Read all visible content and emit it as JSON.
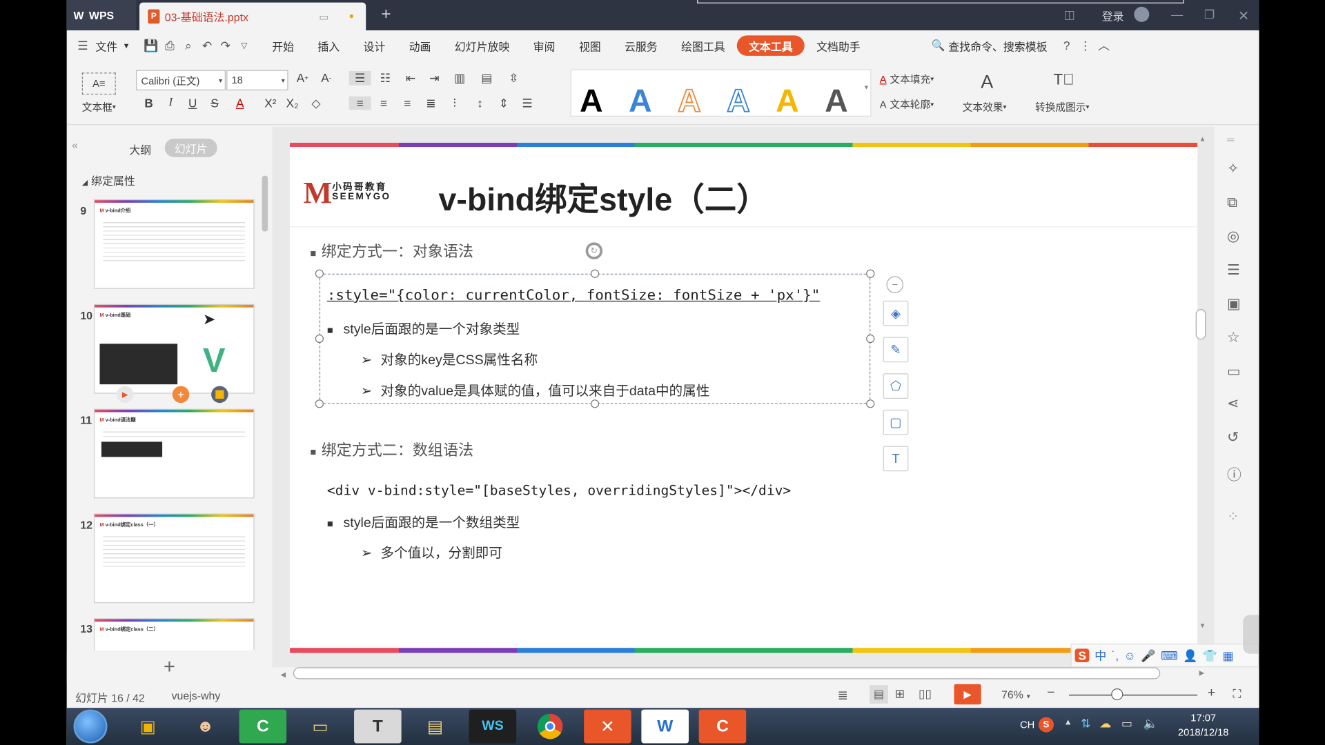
{
  "titlebar": {
    "app_name": "WPS",
    "doc_tab": "03-基础语法.pptx",
    "login_label": "登录"
  },
  "menubar": {
    "file_label": "文件",
    "items": [
      "开始",
      "插入",
      "设计",
      "动画",
      "幻灯片放映",
      "审阅",
      "视图",
      "云服务",
      "绘图工具",
      "文本工具",
      "文档助手"
    ],
    "active_item": "文本工具",
    "search_label": "查找命令、搜索模板"
  },
  "ribbon": {
    "textbox_label": "文本框",
    "font_name": "Calibri (正文)",
    "font_size": "18",
    "text_fill": "文本填充",
    "text_outline": "文本轮廓",
    "text_effect": "文本效果",
    "convert_label": "转换成图示",
    "style_A": "A"
  },
  "leftpanel": {
    "tab_outline": "大纲",
    "tab_slides": "幻灯片",
    "section_label": "绑定属性",
    "slides": [
      {
        "num": "9",
        "title": "v-bind介绍"
      },
      {
        "num": "10",
        "title": "v-bind基础"
      },
      {
        "num": "11",
        "title": "v-bind语法糖"
      },
      {
        "num": "12",
        "title": "v-bind绑定class（一）"
      },
      {
        "num": "13",
        "title": "v-bind绑定class（二）"
      }
    ]
  },
  "slide": {
    "logo_cn": "小码哥教育",
    "logo_en": "SEEMYGO",
    "title": "v-bind绑定style（二）",
    "section1": "绑定方式一：对象语法",
    "code1": ":style=\"{color: currentColor, fontSize: fontSize + 'px'}\"",
    "bullet1": "style后面跟的是一个对象类型",
    "sub1": "对象的key是CSS属性名称",
    "sub2": "对象的value是具体赋的值，值可以来自于data中的属性",
    "section2": "绑定方式二：数组语法",
    "code2": "<div v-bind:style=\"[baseStyles, overridingStyles]\"></div>",
    "bullet2": "style后面跟的是一个数组类型",
    "sub3": "多个值以，分割即可"
  },
  "statusbar": {
    "slide_counter": "幻灯片 16 / 42",
    "theme_name": "vuejs-why",
    "zoom": "76%"
  },
  "taskbar": {
    "ime": "CH",
    "time": "17:07",
    "date": "2018/12/18"
  },
  "ime_toolbar": {
    "mode": "中"
  },
  "colors": {
    "accent": "#e8562a",
    "titlebar": "#2e3442",
    "slide_title": "#222222"
  }
}
